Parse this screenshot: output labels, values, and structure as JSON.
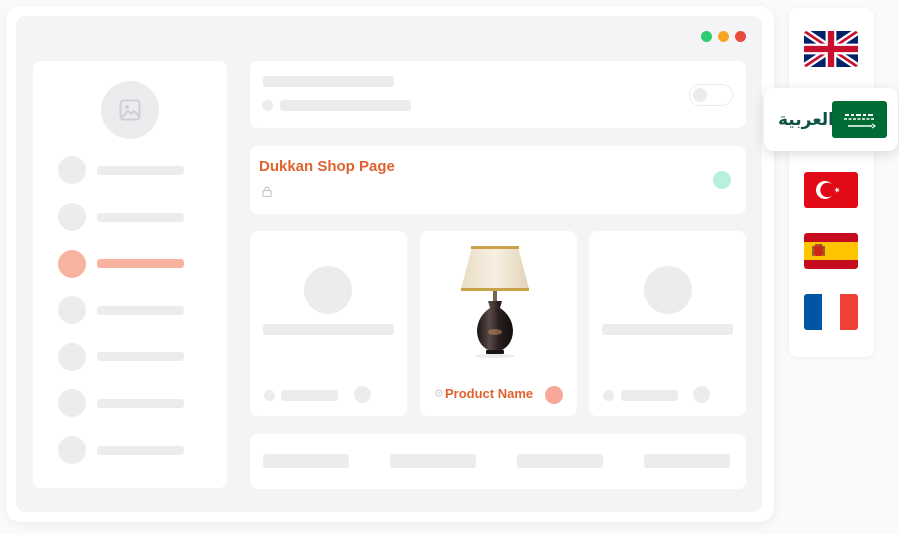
{
  "window": {
    "control_dots": {
      "green": "#2ecc71",
      "yellow": "#f4a524",
      "red": "#e74c3c"
    }
  },
  "sidebar": {
    "avatar_icon": "image-icon",
    "nav_items": 7,
    "active_index": 2,
    "active_color": "#f7b3a0"
  },
  "shop": {
    "title": "Dukkan Shop Page",
    "title_color": "#e0622d",
    "lock_icon": "lock-icon",
    "status_color": "#b8f0e0"
  },
  "product": {
    "name": "Product Name",
    "image": "table-lamp",
    "badge_color": "#f7a898",
    "gear_icon": "gear-icon"
  },
  "languages": {
    "items": [
      {
        "code": "en",
        "flag": "uk-flag"
      },
      {
        "code": "ar",
        "flag": "saudi-flag",
        "label": "العربية",
        "selected": true
      },
      {
        "code": "tr",
        "flag": "turkey-flag"
      },
      {
        "code": "es",
        "flag": "spain-flag"
      },
      {
        "code": "fr",
        "flag": "france-flag"
      }
    ],
    "selected_label": "العربية"
  }
}
